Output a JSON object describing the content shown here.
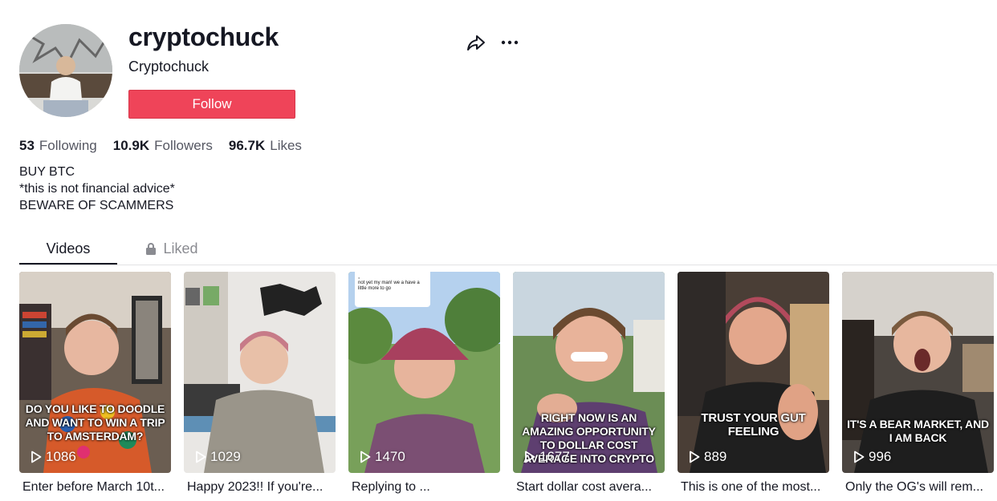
{
  "profile": {
    "username": "cryptochuck",
    "nickname": "Cryptochuck",
    "follow_label": "Follow"
  },
  "stats": [
    {
      "value": "53",
      "label": "Following"
    },
    {
      "value": "10.9K",
      "label": "Followers"
    },
    {
      "value": "96.7K",
      "label": "Likes"
    }
  ],
  "bio": [
    "BUY BTC",
    "*this is not financial advice*",
    "BEWARE OF SCAMMERS"
  ],
  "tabs": [
    {
      "label": "Videos",
      "active": true
    },
    {
      "label": "Liked",
      "active": false,
      "icon": "lock-icon"
    }
  ],
  "videos": [
    {
      "views": "1086",
      "overlay": "DO YOU LIKE TO DOODLE AND WANT TO WIN A TRIP TO AMSTERDAM?",
      "description": "Enter before March 10t..."
    },
    {
      "views": "1029",
      "overlay": "",
      "description": "Happy 2023!! If you're..."
    },
    {
      "views": "1470",
      "overlay": "",
      "description": "Replying to ...",
      "reply_text": "not yet my man! we a have a little more to go"
    },
    {
      "views": "1677",
      "overlay": "RIGHT NOW IS AN AMAZING OPPORTUNITY TO DOLLAR COST AVERAGE INTO CRYPTO",
      "description": "Start dollar cost avera..."
    },
    {
      "views": "889",
      "overlay": "TRUST YOUR GUT FEELING",
      "description": "This is one of the most..."
    },
    {
      "views": "996",
      "overlay": "IT'S A BEAR MARKET, AND I AM BACK",
      "description": "Only the OG's will rem..."
    }
  ],
  "colors": {
    "accent": "#ef4459",
    "text": "#161823",
    "secondary_text": "#555762"
  },
  "icons": [
    "share-icon",
    "more-icon",
    "play-icon",
    "lock-icon"
  ]
}
